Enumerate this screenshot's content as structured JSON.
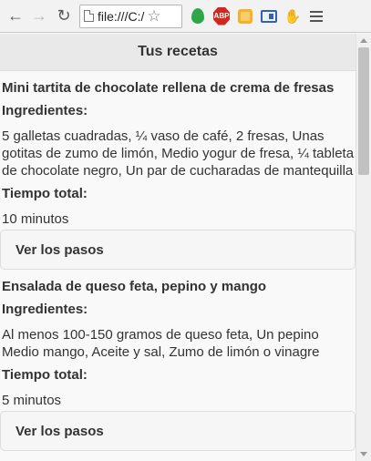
{
  "browser": {
    "url": "file:///C:/",
    "icons": [
      "back-arrow-icon",
      "forward-arrow-icon",
      "reload-icon",
      "bookmark-star-icon",
      "leaf-extension-icon",
      "adblock-plus-icon",
      "cube-extension-icon",
      "screenshot-extension-icon",
      "hand-extension-icon",
      "menu-icon"
    ],
    "abp_text": "ABP"
  },
  "app": {
    "title": "Tus recetas"
  },
  "recipes": [
    {
      "title": "Mini tartita de chocolate rellena de crema de fresas",
      "ingredients_label": "Ingredientes:",
      "ingredients": "5 galletas cuadradas, ¼ vaso de café, 2 fresas, Unas gotitas de zumo de limón, Medio yogur de fresa, ¼ tableta de chocolate negro, Un par de cucharadas de mantequilla",
      "time_label": "Tiempo total:",
      "time": "10 minutos",
      "steps_label": "Ver los pasos"
    },
    {
      "title": "Ensalada de queso feta, pepino y mango",
      "ingredients_label": "Ingredientes:",
      "ingredients": "Al menos 100-150 gramos de queso feta, Un pepino Medio mango, Aceite y sal, Zumo de limón o vinagre",
      "time_label": "Tiempo total:",
      "time": "5 minutos",
      "steps_label": "Ver los pasos"
    }
  ]
}
